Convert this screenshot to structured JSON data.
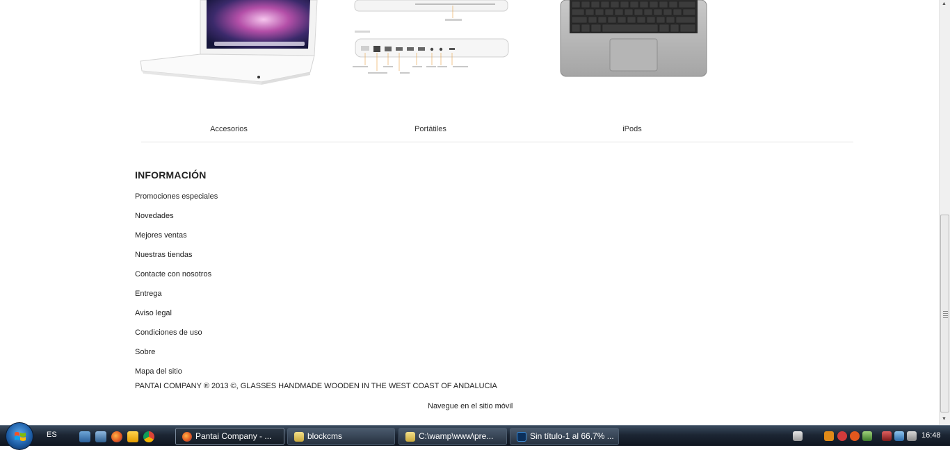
{
  "categories": {
    "items": [
      {
        "label": "Accesorios"
      },
      {
        "label": "Portátiles"
      },
      {
        "label": "iPods"
      }
    ]
  },
  "info": {
    "title": "INFORMACIÓN",
    "links": [
      "Promociones especiales",
      "Novedades",
      "Mejores ventas",
      "Nuestras tiendas",
      "Contacte con nosotros",
      "Entrega",
      "Aviso legal",
      "Condiciones de uso",
      "Sobre",
      "Mapa del sitio"
    ]
  },
  "footer": {
    "copyright": "PANTAI COMPANY ® 2013 ©, GLASSES HANDMADE WOODEN IN THE WEST COAST OF ANDALUCIA",
    "mobile_link": "Navegue en el sitio móvil"
  },
  "taskbar": {
    "language": "ES",
    "tasks": [
      {
        "label": "Pantai Company - ...",
        "icon": "firefox-icon",
        "active": true
      },
      {
        "label": "blockcms",
        "icon": "folder-icon",
        "active": false
      },
      {
        "label": "C:\\wamp\\www\\pre...",
        "icon": "folder-icon",
        "active": false
      },
      {
        "label": "Sin título-1 al 66,7% ...",
        "icon": "photoshop-icon",
        "active": false
      }
    ],
    "clock": "16:48"
  },
  "colors": {
    "accent": "#1e5fa8",
    "taskbar": "#1c2634"
  }
}
